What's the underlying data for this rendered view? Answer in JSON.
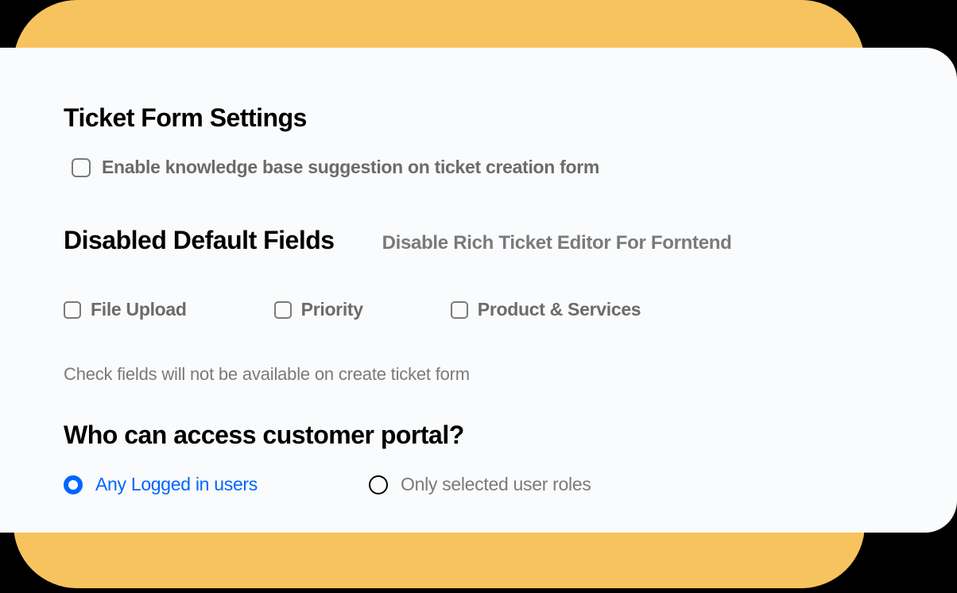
{
  "sections": {
    "ticketForm": {
      "title": "Ticket Form Settings",
      "enableKbLabel": "Enable knowledge base suggestion on ticket creation form"
    },
    "disabledFields": {
      "title": "Disabled Default Fields",
      "subtitle": "Disable Rich Ticket Editor For Forntend",
      "fields": {
        "fileUpload": "File Upload",
        "priority": "Priority",
        "productServices": "Product & Services"
      },
      "helperText": "Check fields will not be available on create ticket form"
    },
    "access": {
      "title": "Who can access customer portal?",
      "options": {
        "anyLogged": "Any Logged in users",
        "selectedRoles": "Only selected user roles"
      }
    }
  }
}
